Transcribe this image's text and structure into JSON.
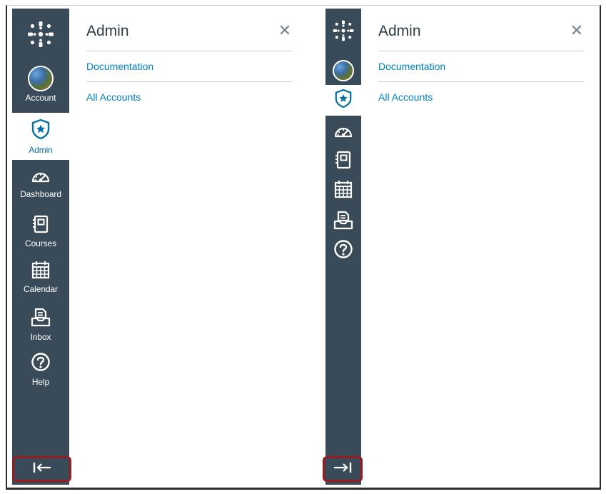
{
  "left_panel": {
    "nav": {
      "items": [
        {
          "key": "account",
          "label": "Account",
          "icon": "avatar"
        },
        {
          "key": "admin",
          "label": "Admin",
          "icon": "shield-star-icon",
          "active": true
        },
        {
          "key": "dashboard",
          "label": "Dashboard",
          "icon": "speedometer-icon"
        },
        {
          "key": "courses",
          "label": "Courses",
          "icon": "courses-book-icon"
        },
        {
          "key": "calendar",
          "label": "Calendar",
          "icon": "calendar-icon"
        },
        {
          "key": "inbox",
          "label": "Inbox",
          "icon": "inbox-icon"
        },
        {
          "key": "help",
          "label": "Help",
          "icon": "help-question-icon"
        }
      ],
      "collapse_glyph": "|←"
    },
    "tray": {
      "title": "Admin",
      "close_glyph": "✕",
      "links": [
        "Documentation",
        "All Accounts"
      ]
    }
  },
  "right_panel": {
    "nav": {
      "expand_glyph": "→|"
    },
    "tray": {
      "title": "Admin",
      "close_glyph": "✕",
      "links": [
        "Documentation",
        "All Accounts"
      ]
    }
  },
  "colors": {
    "nav_bg": "#394b58",
    "active_text": "#0770a3",
    "link": "#0081c8",
    "highlight_border": "#9a1a1f"
  }
}
